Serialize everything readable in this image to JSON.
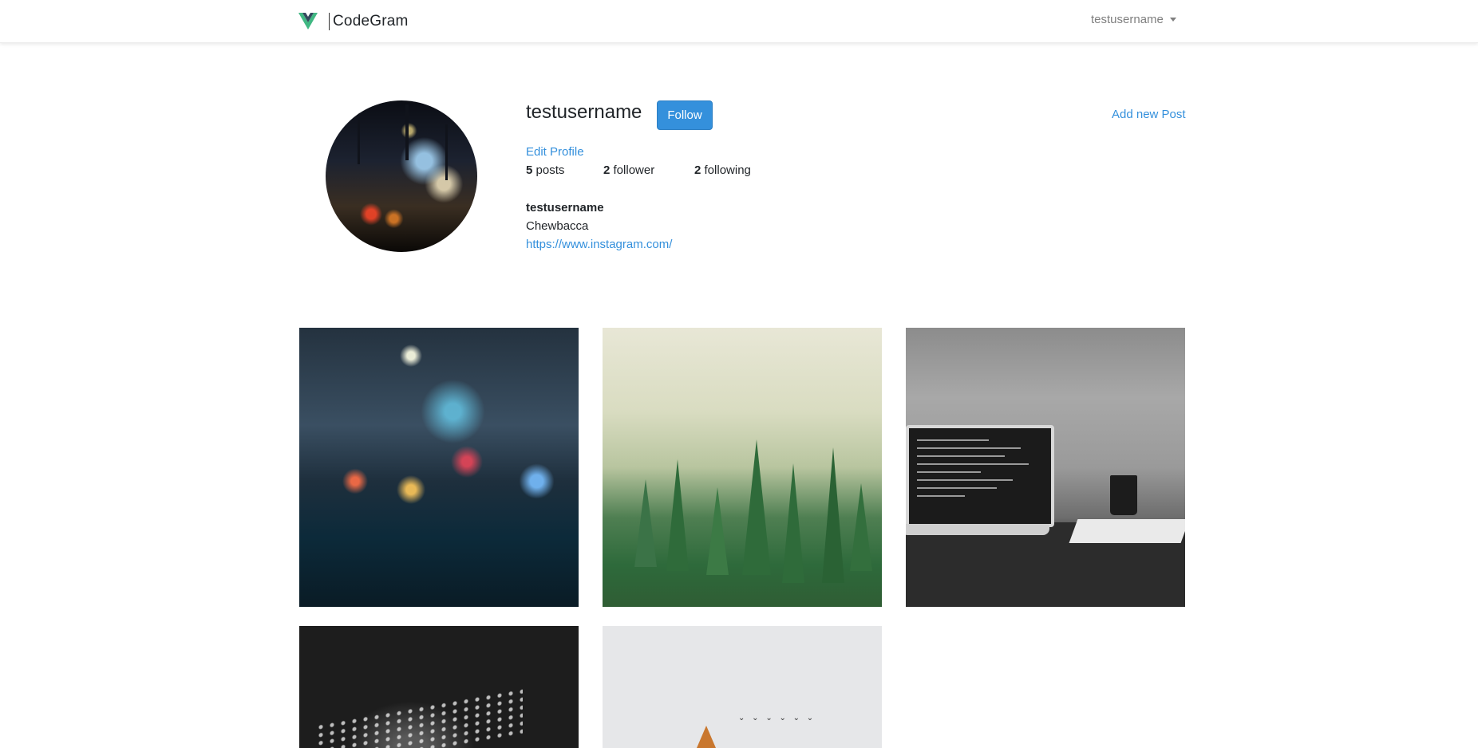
{
  "navbar": {
    "brand_name": "CodeGram",
    "logo_icon": "vue-logo-icon",
    "user_menu_label": "testusername"
  },
  "profile": {
    "username": "testusername",
    "follow_label": "Follow",
    "add_post_label": "Add new Post",
    "edit_profile_label": "Edit Profile",
    "stats": {
      "posts_count": "5",
      "posts_label": "posts",
      "followers_count": "2",
      "followers_label": "follower",
      "following_count": "2",
      "following_label": "following"
    },
    "bio": {
      "title": "testusername",
      "description": "Chewbacca",
      "url": "https://www.instagram.com/"
    }
  },
  "posts": [
    {
      "subject": "rainy city street at night"
    },
    {
      "subject": "misty pine forest"
    },
    {
      "subject": "laptop and mug on desk in black and white"
    },
    {
      "subject": "keyboard in dark light"
    },
    {
      "subject": "orange tree with birds"
    }
  ],
  "colors": {
    "accent": "#3490dc",
    "brand_green": "#41b883",
    "brand_dark": "#34495e",
    "text": "#212529",
    "muted": "#7f7f7f"
  }
}
